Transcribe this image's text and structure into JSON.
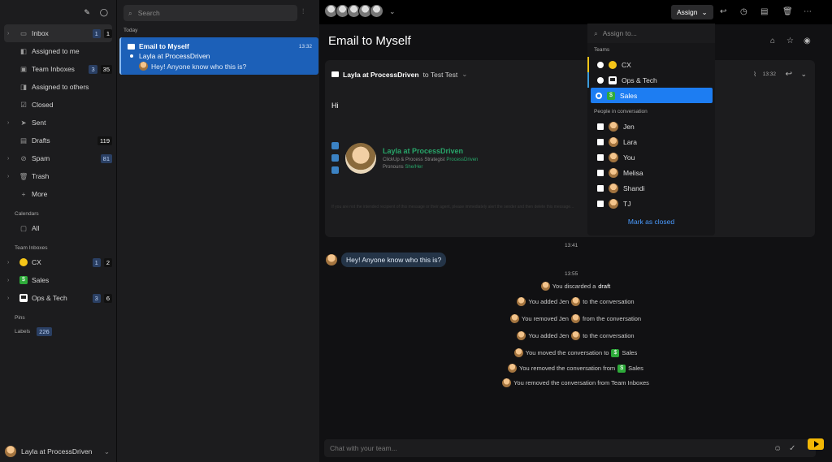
{
  "sidebar": {
    "items": [
      {
        "label": "Inbox",
        "icon": "inbox-icon",
        "badge_left": "1",
        "badge_right": "1",
        "chevron": true,
        "active": true
      },
      {
        "label": "Assigned to me",
        "icon": "assigned-icon"
      },
      {
        "label": "Team Inboxes",
        "icon": "team-inbox-icon",
        "badge_left": "3",
        "badge_right": "35"
      },
      {
        "label": "Assigned to others",
        "icon": "assigned-others-icon"
      },
      {
        "label": "Closed",
        "icon": "check-icon"
      },
      {
        "label": "Sent",
        "icon": "send-icon",
        "chevron": true
      },
      {
        "label": "Drafts",
        "icon": "draft-icon",
        "badge_right": "119"
      },
      {
        "label": "Spam",
        "icon": "spam-icon",
        "badge_left": "81",
        "chevron": true
      },
      {
        "label": "Trash",
        "icon": "trash-icon",
        "chevron": true
      },
      {
        "label": "More",
        "icon": "plus-icon"
      }
    ],
    "calendars_label": "Calendars",
    "calendars_all": "All",
    "team_inboxes_label": "Team Inboxes",
    "teams": [
      {
        "label": "CX",
        "badge_left": "1",
        "badge_right": "2"
      },
      {
        "label": "Sales"
      },
      {
        "label": "Ops & Tech",
        "badge_left": "3",
        "badge_right": "6"
      }
    ],
    "pins_label": "Pins",
    "labels_label": "Labels",
    "labels_count": "226",
    "user": "Layla at ProcessDriven"
  },
  "list": {
    "search_placeholder": "Search",
    "day": "Today",
    "conversation": {
      "title": "Email to Myself",
      "time": "13:32",
      "from": "Layla at ProcessDriven",
      "preview": "Hey! Anyone know who this is?"
    }
  },
  "toolbar": {
    "assign_label": "Assign"
  },
  "main": {
    "title": "Email to Myself",
    "email": {
      "sender": "Layla at ProcessDriven",
      "to_text": "to Test Test",
      "time": "13:32",
      "body": "Hi",
      "signature": {
        "name": "Layla at ProcessDriven",
        "role": "ClickUp & Process Strategist",
        "company": "ProcessDriven",
        "pronouns": "Pronouns",
        "pronouns_value": "She/Her"
      },
      "disclaimer": "If you are not the intended recipient of this message or their agent, please immediately alert the sender and then delete this message..."
    },
    "ts1": "13:41",
    "chat_message": "Hey! Anyone know who this is?",
    "ts2": "13:55",
    "activity": {
      "a1": "You discarded a",
      "a1_b": "draft",
      "a2": "You added Jen",
      "a2_b": "to the conversation",
      "a3": "You removed Jen",
      "a3_b": "from the conversation",
      "a4": "You added Jen",
      "a4_b": "to the conversation",
      "a5": "You moved the conversation to",
      "a5_b": "Sales",
      "a6": "You removed the conversation from",
      "a6_b": "Sales",
      "a7": "You removed the conversation from Team Inboxes"
    },
    "chat_placeholder": "Chat with your team..."
  },
  "dropdown": {
    "search_placeholder": "Assign to...",
    "teams_label": "Teams",
    "teams": [
      "CX",
      "Ops & Tech",
      "Sales"
    ],
    "people_label": "People in conversation",
    "people": [
      "Jen",
      "Lara",
      "You",
      "Melisa",
      "Shandi",
      "TJ"
    ],
    "mark_closed": "Mark as closed"
  },
  "colors": {
    "accent": "#1d7df2",
    "selected": "#1c60b8",
    "sig_green": "#28a66a",
    "sales_green": "#2eab3a",
    "cx_yellow": "#f5c518"
  }
}
